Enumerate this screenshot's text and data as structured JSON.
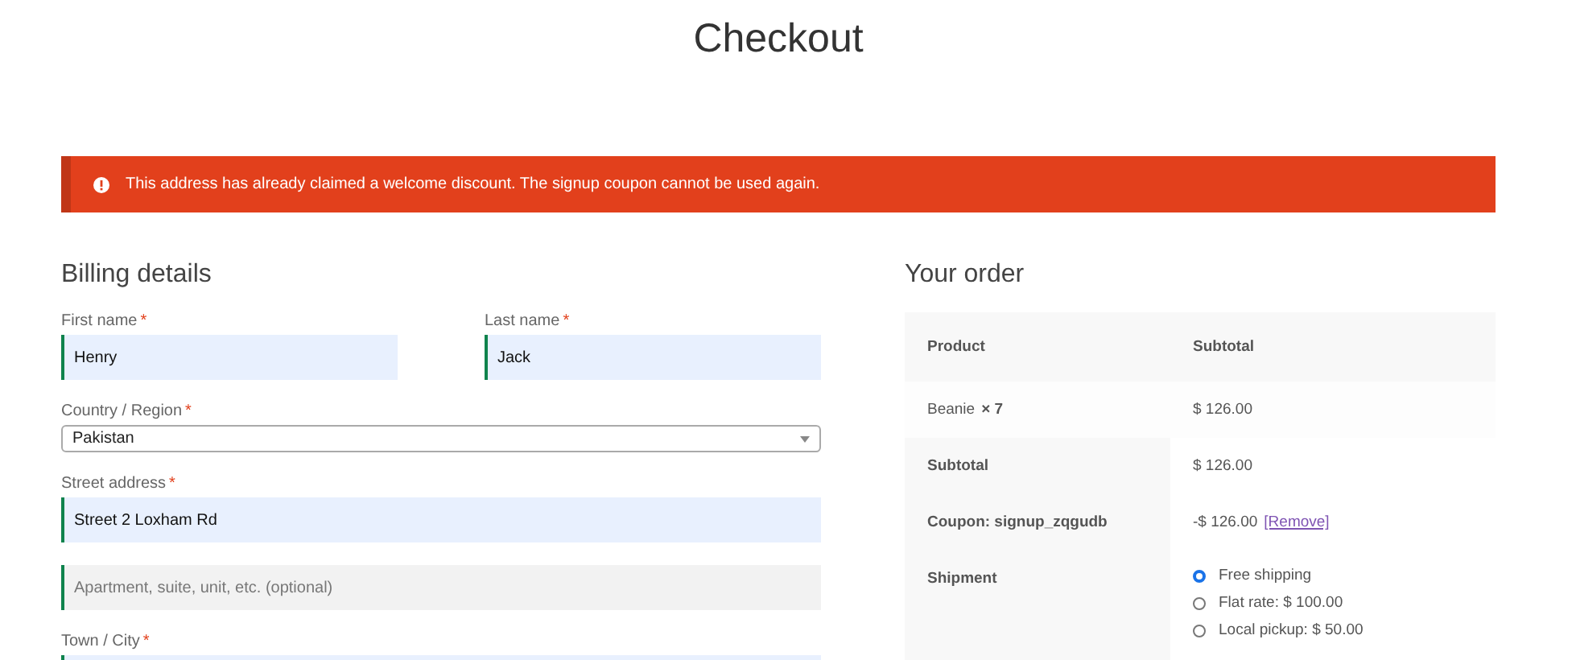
{
  "page_title": "Checkout",
  "notice": {
    "kind": "error",
    "text": "This address has already claimed a welcome discount. The signup coupon cannot be used again."
  },
  "billing": {
    "heading": "Billing details",
    "rows": [
      {
        "fields": [
          {
            "kind": "text",
            "label": "First name",
            "required_mark": "*",
            "value": "Henry",
            "validated": true,
            "autofilled": true
          },
          {
            "kind": "text",
            "label": "Last name",
            "required_mark": "*",
            "value": "Jack",
            "validated": true,
            "autofilled": true
          }
        ]
      },
      {
        "fields": [
          {
            "kind": "select",
            "label": "Country / Region",
            "required_mark": "*",
            "value": "Pakistan",
            "validated": false
          }
        ]
      },
      {
        "fields": [
          {
            "kind": "text",
            "label": "Street address",
            "required_mark": "*",
            "value": "Street 2 Loxham Rd",
            "validated": true,
            "autofilled": true
          }
        ]
      },
      {
        "fields": [
          {
            "kind": "text",
            "placeholder": "Apartment, suite, unit, etc. (optional)",
            "validated": true,
            "autofilled": false
          }
        ]
      },
      {
        "fields": [
          {
            "kind": "text",
            "label": "Town / City",
            "required_mark": "*",
            "validated": true,
            "autofilled": true
          }
        ]
      }
    ]
  },
  "order": {
    "heading": "Your order",
    "columns": [
      "Product",
      "Subtotal"
    ],
    "items": [
      {
        "product": "Beanie",
        "quantity": "× 7",
        "subtotal": "$ 126.00"
      }
    ],
    "totals": [
      {
        "kind": "amount",
        "label": "Subtotal",
        "value": "$ 126.00"
      },
      {
        "kind": "coupon",
        "label": "Coupon: signup_zqgudb",
        "value": "-$ 126.00",
        "link": "[Remove]"
      },
      {
        "kind": "shipping",
        "label": "Shipment",
        "options": [
          {
            "label": "Free shipping",
            "selected": true
          },
          {
            "label": "Flat rate: $ 100.00",
            "selected": false
          },
          {
            "label": "Local pickup: $ 50.00",
            "selected": false
          }
        ]
      }
    ]
  }
}
